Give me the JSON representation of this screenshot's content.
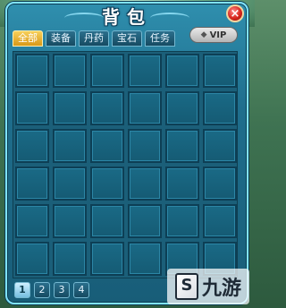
{
  "window": {
    "title": "背包",
    "close_symbol": "×"
  },
  "tabs": [
    {
      "label": "全部",
      "active": true
    },
    {
      "label": "装备",
      "active": false
    },
    {
      "label": "丹药",
      "active": false
    },
    {
      "label": "宝石",
      "active": false
    },
    {
      "label": "任务",
      "active": false
    }
  ],
  "vip": {
    "label": "VIP",
    "icon": "gem-icon"
  },
  "inventory": {
    "columns": 6,
    "rows": 6
  },
  "pager": {
    "pages": [
      "1",
      "2",
      "3",
      "4"
    ],
    "current": "1"
  },
  "watermark": {
    "logo": "S",
    "text": "九游"
  },
  "colors": {
    "panel_border": "#7fe3ff",
    "panel_fill": "#1f6e8d",
    "tab_active": "#f7d05b",
    "close_button": "#d7261d"
  }
}
